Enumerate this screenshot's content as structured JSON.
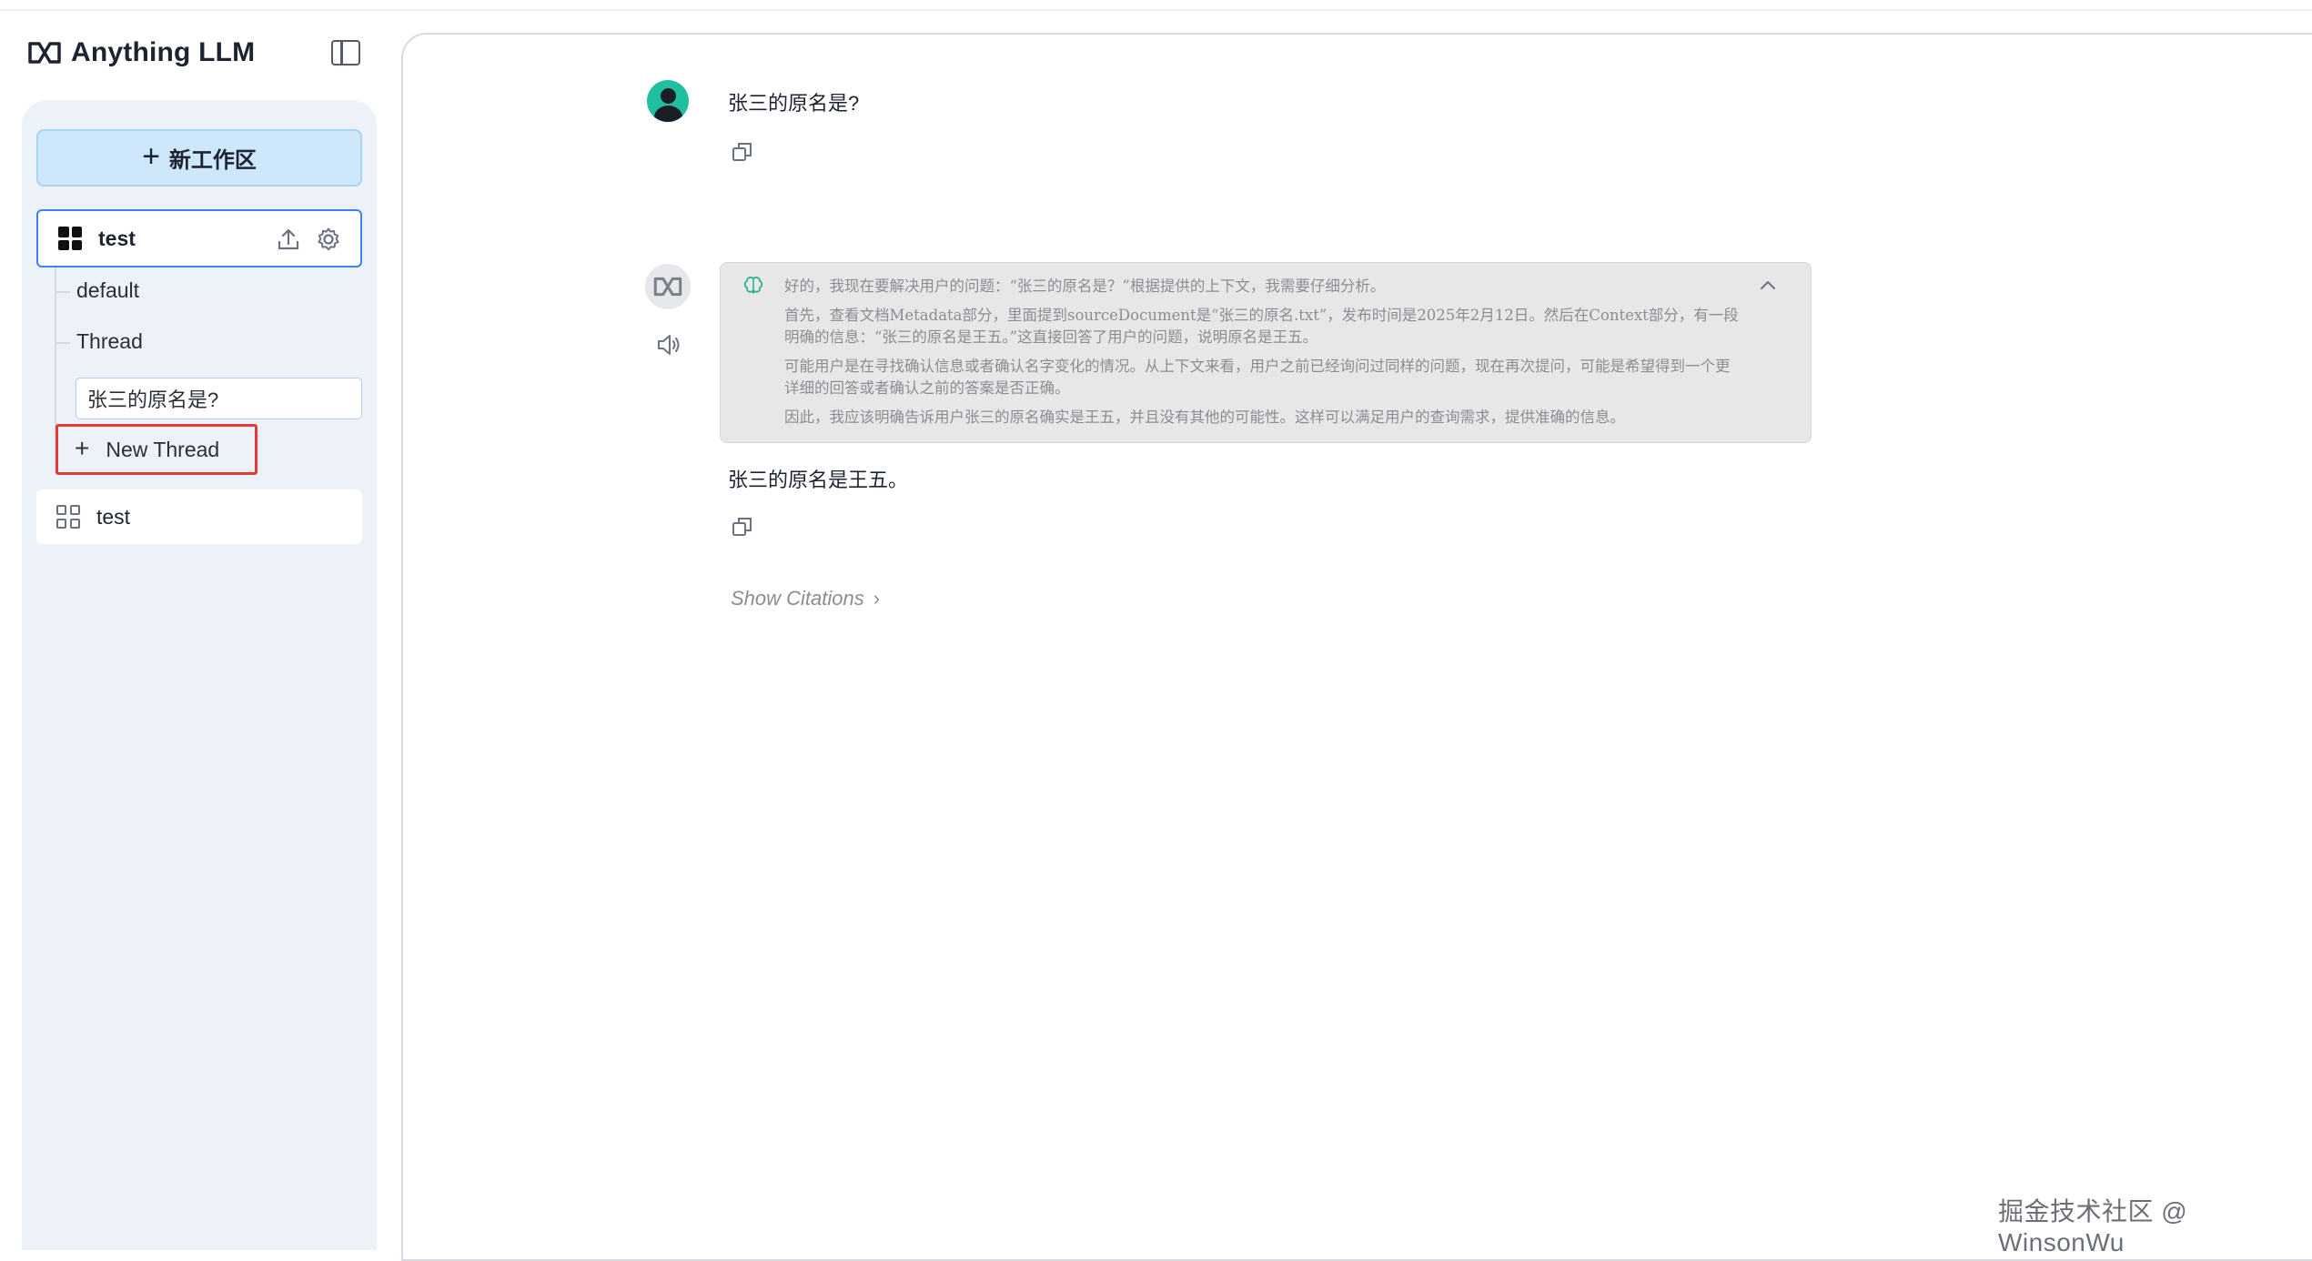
{
  "app": {
    "brand": "Anything LLM"
  },
  "sidebar": {
    "new_workspace_label": "新工作区",
    "workspaces": [
      {
        "name": "test",
        "active": true
      },
      {
        "name": "test",
        "active": false
      }
    ],
    "threads": [
      {
        "label": "default"
      },
      {
        "label": "Thread"
      },
      {
        "label": "张三的原名是?"
      }
    ],
    "new_thread_label": "New Thread"
  },
  "chat": {
    "user_message": "张三的原名是?",
    "thinking": [
      "好的，我现在要解决用户的问题：“张三的原名是？”根据提供的上下文，我需要仔细分析。",
      "首先，查看文档Metadata部分，里面提到sourceDocument是“张三的原名.txt”，发布时间是2025年2月12日。然后在Context部分，有一段明确的信息：“张三的原名是王五。”这直接回答了用户的问题，说明原名是王五。",
      "可能用户是在寻找确认信息或者确认名字变化的情况。从上下文来看，用户之前已经询问过同样的问题，现在再次提问，可能是希望得到一个更详细的回答或者确认之前的答案是否正确。",
      "因此，我应该明确告诉用户张三的原名确实是王五，并且没有其他的可能性。这样可以满足用户的查询需求，提供准确的信息。"
    ],
    "answer": "张三的原名是王五。",
    "show_citations_label": "Show Citations"
  },
  "watermark": "掘金技术社区 @ WinsonWu",
  "colors": {
    "accent": "#3b82f6",
    "new_workspace_bg": "#cfe7fb",
    "highlight_border": "#e53935",
    "sidebar_bg": "#edf1f8",
    "avatar": "#1fbf9f"
  }
}
